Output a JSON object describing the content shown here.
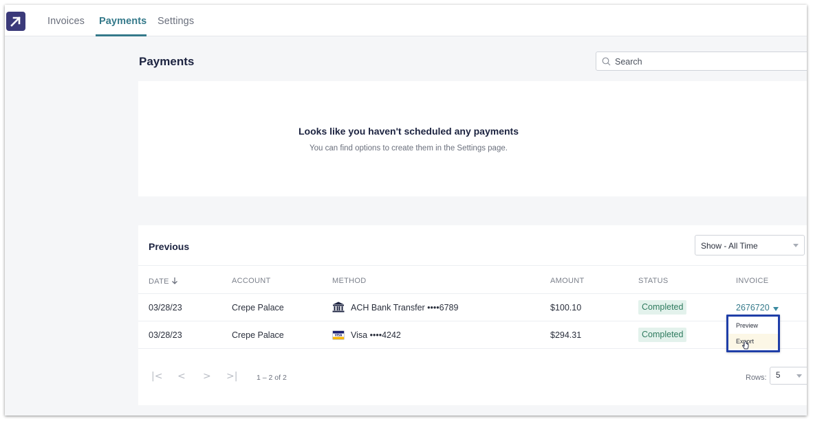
{
  "nav": {
    "tabs": [
      {
        "label": "Invoices",
        "active": false
      },
      {
        "label": "Payments",
        "active": true
      },
      {
        "label": "Settings",
        "active": false
      }
    ]
  },
  "page": {
    "title": "Payments",
    "search_placeholder": "Search"
  },
  "empty_state": {
    "title": "Looks like you haven't scheduled any payments",
    "subtitle": "You can find options to create them in the Settings page."
  },
  "previous": {
    "title": "Previous",
    "filter": {
      "selected": "Show - All Time"
    },
    "columns": [
      "DATE",
      "ACCOUNT",
      "METHOD",
      "AMOUNT",
      "STATUS",
      "INVOICE"
    ],
    "rows": [
      {
        "date": "03/28/23",
        "account": "Crepe Palace",
        "method": "ACH Bank Transfer ••••6789",
        "method_icon": "bank-icon",
        "amount": "$100.10",
        "status": "Completed",
        "invoice": "2676720"
      },
      {
        "date": "03/28/23",
        "account": "Crepe Palace",
        "method": "Visa ••••4242",
        "method_icon": "visa-card-icon",
        "amount": "$294.31",
        "status": "Completed",
        "invoice": ""
      }
    ],
    "invoice_menu": {
      "items": [
        "Preview",
        "Export"
      ]
    },
    "pagination": {
      "range": "1 – 2 of 2",
      "rows_label": "Rows:",
      "rows_value": "5"
    }
  },
  "colors": {
    "brand": "#3b3a7a",
    "accent": "#34798a",
    "status_bg": "#e3f2ec",
    "status_text": "#2e7a5e",
    "menu_border": "#1f3ea8"
  }
}
